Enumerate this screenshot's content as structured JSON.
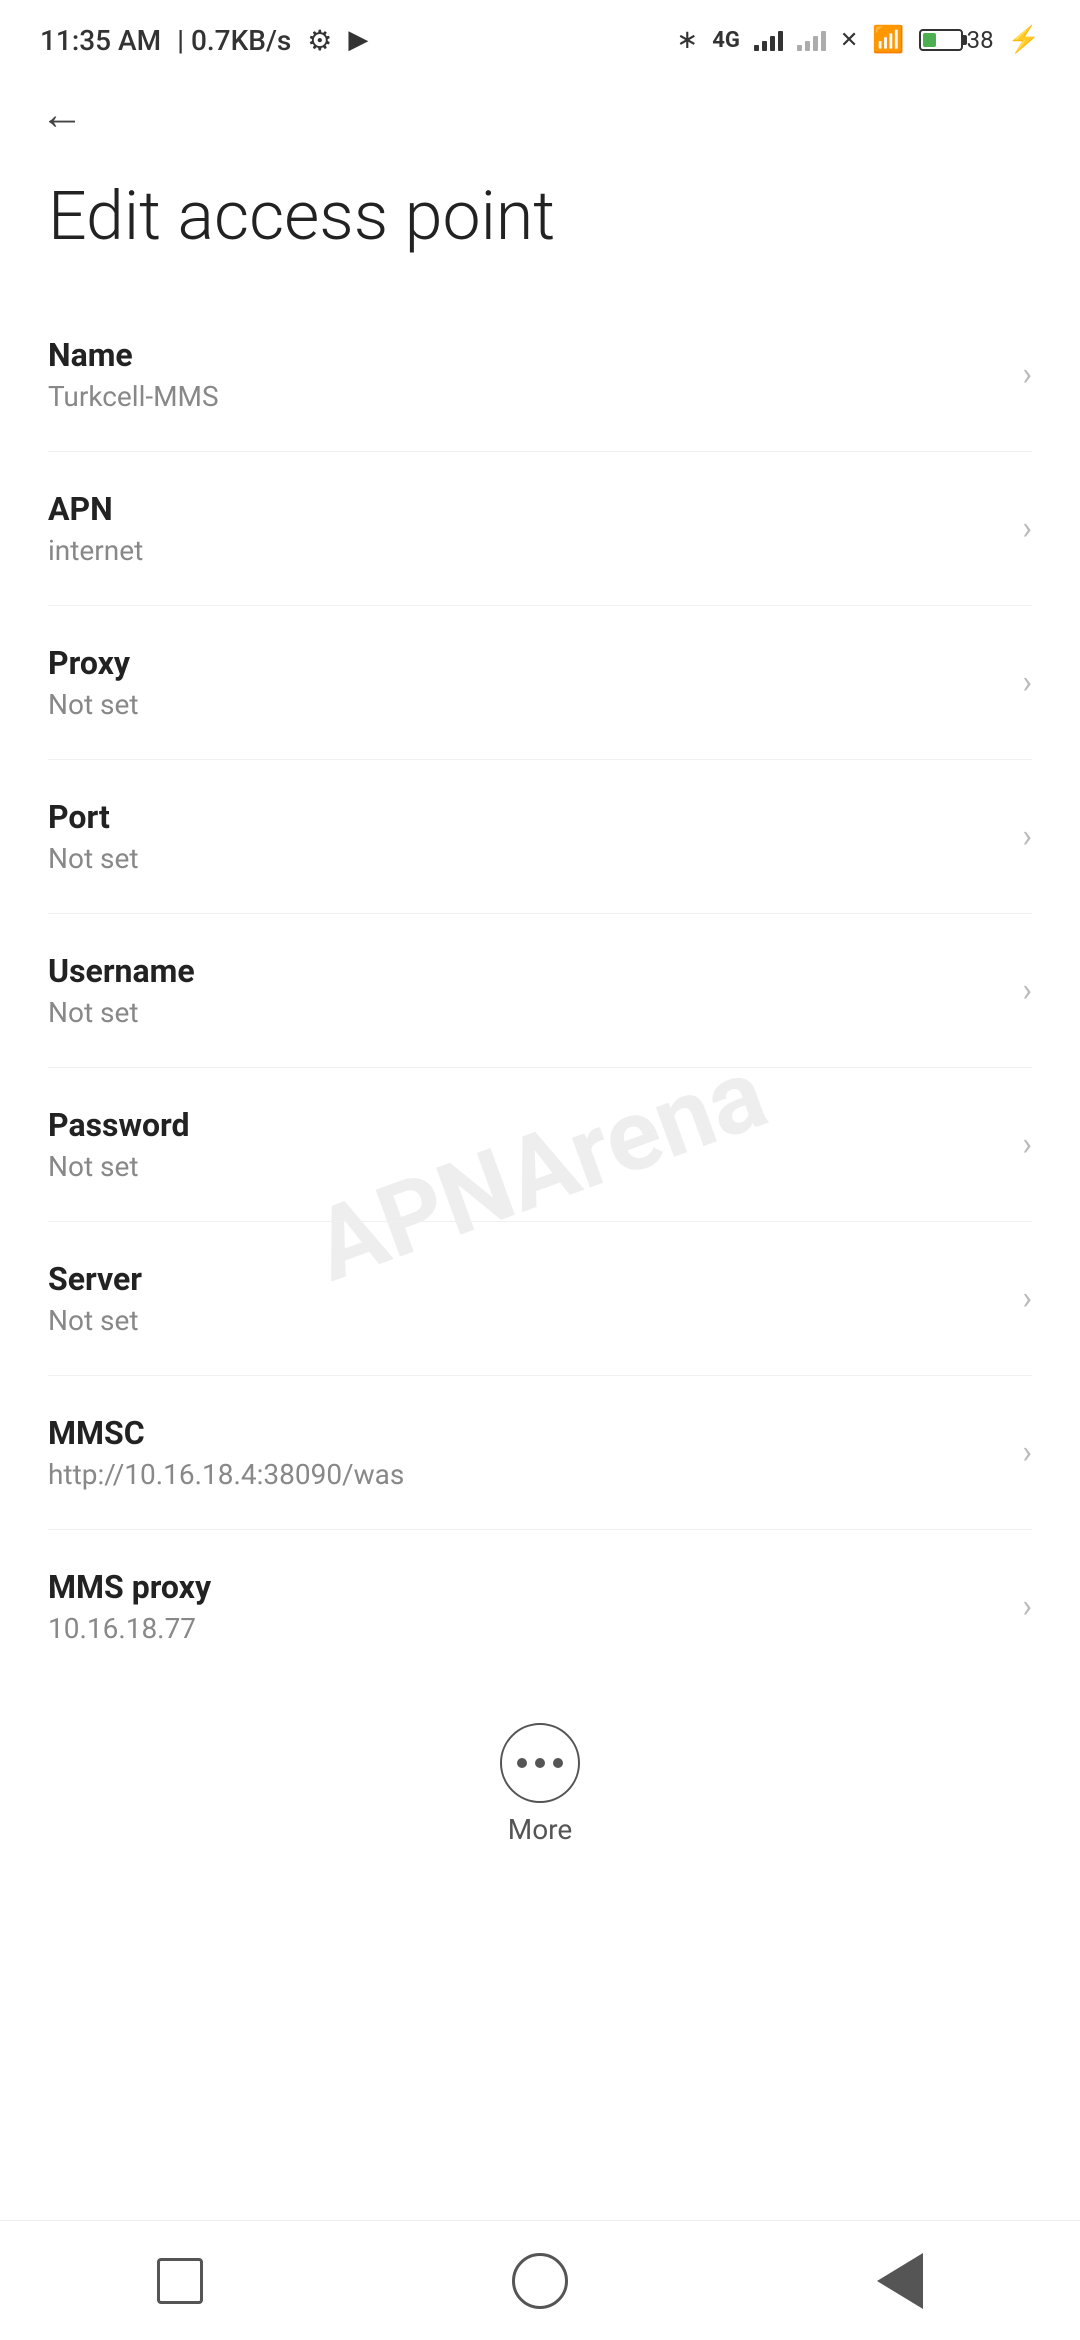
{
  "statusBar": {
    "time": "11:35 AM",
    "speed": "0.7KB/s",
    "battery": "38"
  },
  "toolbar": {
    "backLabel": "←"
  },
  "page": {
    "title": "Edit access point"
  },
  "settings": [
    {
      "label": "Name",
      "value": "Turkcell-MMS"
    },
    {
      "label": "APN",
      "value": "internet"
    },
    {
      "label": "Proxy",
      "value": "Not set"
    },
    {
      "label": "Port",
      "value": "Not set"
    },
    {
      "label": "Username",
      "value": "Not set"
    },
    {
      "label": "Password",
      "value": "Not set"
    },
    {
      "label": "Server",
      "value": "Not set"
    },
    {
      "label": "MMSC",
      "value": "http://10.16.18.4:38090/was"
    },
    {
      "label": "MMS proxy",
      "value": "10.16.18.77"
    }
  ],
  "more": {
    "label": "More"
  },
  "watermark": {
    "text": "APNArena"
  }
}
